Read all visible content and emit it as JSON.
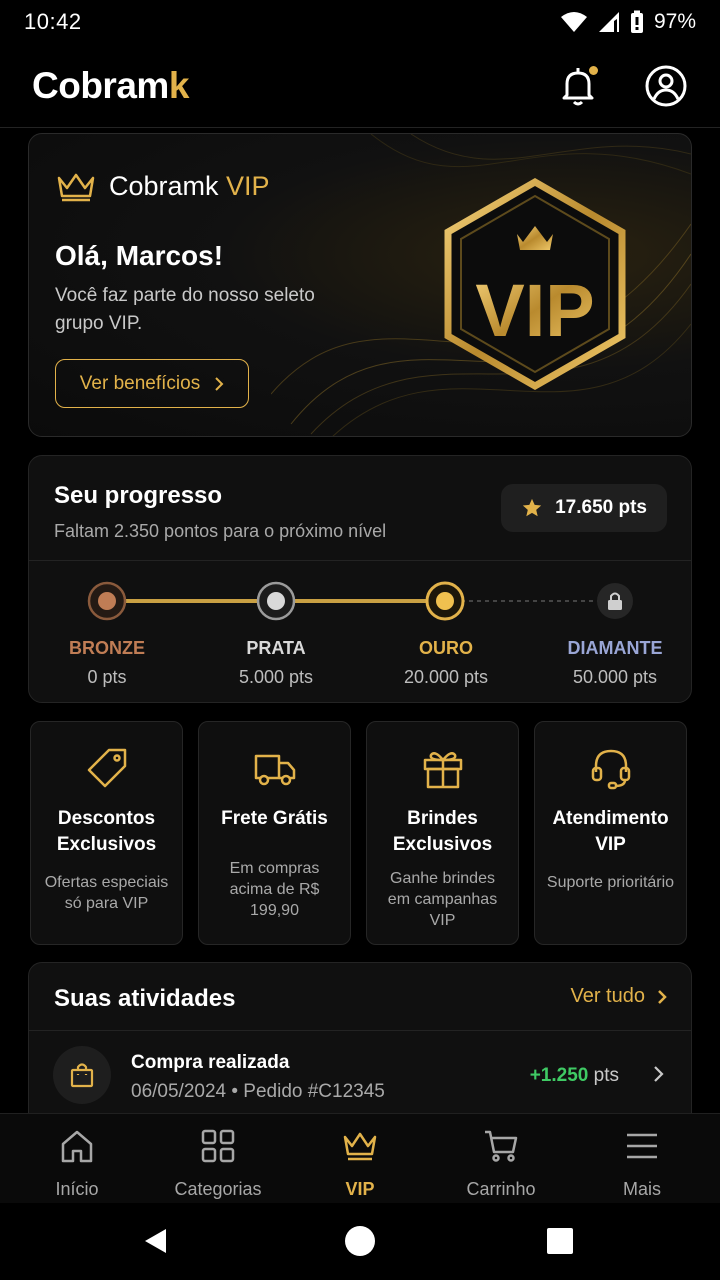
{
  "status_bar": {
    "time": "10:42",
    "battery": "97%"
  },
  "header": {
    "logo_main": "Cobram",
    "logo_accent": "k"
  },
  "hero": {
    "brand": "Cobramk",
    "brand_vip": "VIP",
    "greeting": "Olá, Marcos!",
    "subtitle": "Você faz parte do nosso seleto grupo VIP.",
    "button_label": "Ver benefícios",
    "badge_text": "VIP"
  },
  "progress": {
    "title": "Seu progresso",
    "subtitle": "Faltam 2.350 pontos para o próximo nível",
    "points": "17.650 pts",
    "tiers": [
      {
        "name": "BRONZE",
        "pts": "0 pts",
        "color": "#c07d55"
      },
      {
        "name": "PRATA",
        "pts": "5.000 pts",
        "color": "#d9d9d9"
      },
      {
        "name": "OURO",
        "pts": "20.000 pts",
        "color": "#e2b24a"
      },
      {
        "name": "DIAMANTE",
        "pts": "50.000 pts",
        "color": "#9aa6d6"
      }
    ]
  },
  "benefits": [
    {
      "title": "Descontos Exclusivos",
      "desc": "Ofertas especiais só para VIP",
      "icon": "tag-icon"
    },
    {
      "title": "Frete Grátis",
      "desc": "Em compras acima de R$ 199,90",
      "icon": "truck-icon"
    },
    {
      "title": "Brindes Exclusivos",
      "desc": "Ganhe brindes em campanhas VIP",
      "icon": "gift-icon"
    },
    {
      "title": "Atendimento VIP",
      "desc": "Suporte prioritário",
      "icon": "headset-icon"
    }
  ],
  "activities": {
    "title": "Suas atividades",
    "see_all": "Ver tudo",
    "items": [
      {
        "name": "Compra realizada",
        "meta": "06/05/2024 • Pedido #C12345",
        "points": "+1.250",
        "points_unit": "pts"
      }
    ]
  },
  "nav": [
    {
      "label": "Início"
    },
    {
      "label": "Categorias"
    },
    {
      "label": "VIP"
    },
    {
      "label": "Carrinho"
    },
    {
      "label": "Mais"
    }
  ],
  "colors": {
    "accent": "#e2b24a",
    "positive": "#3fca64",
    "background": "#000000"
  }
}
